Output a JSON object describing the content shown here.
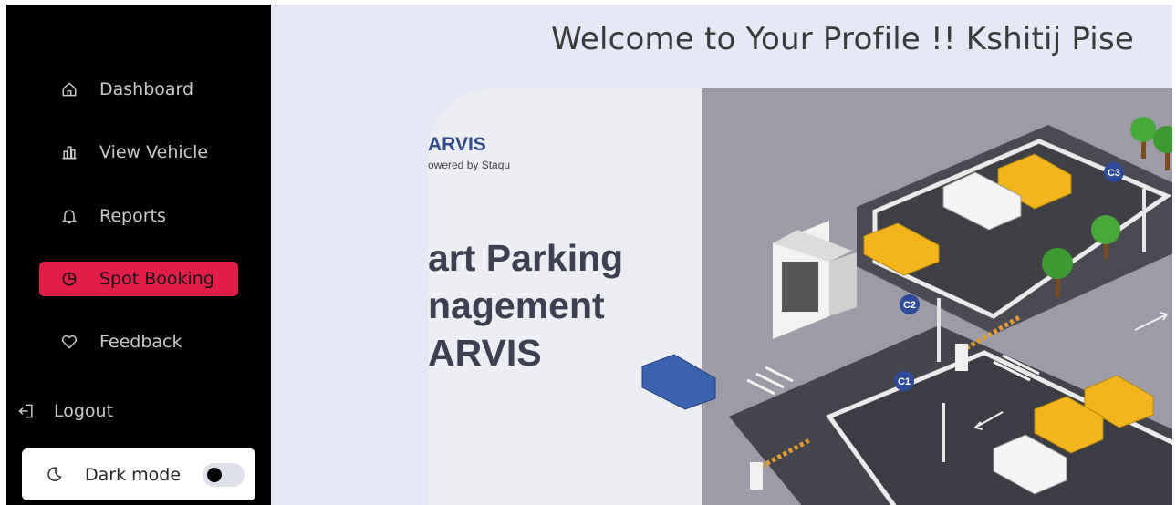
{
  "sidebar": {
    "items": [
      {
        "label": "Dashboard",
        "icon": "home-icon",
        "active": false
      },
      {
        "label": "View Vehicle",
        "icon": "bar-chart-icon",
        "active": false
      },
      {
        "label": "Reports",
        "icon": "bell-icon",
        "active": false
      },
      {
        "label": "Spot Booking",
        "icon": "pie-chart-icon",
        "active": true
      },
      {
        "label": "Feedback",
        "icon": "heart-icon",
        "active": false
      }
    ],
    "logout_label": "Logout",
    "dark_mode_label": "Dark mode",
    "dark_mode_on": false
  },
  "header": {
    "welcome_text": "Welcome to Your Profile !! Kshitij Pise"
  },
  "banner": {
    "brand_name": "ARVIS",
    "brand_sub": "owered by Staqu",
    "headline_lines": [
      "art Parking",
      "nagement",
      "ARVIS"
    ],
    "zone_labels": [
      "C3",
      "C2",
      "C1"
    ]
  },
  "colors": {
    "sidebar_bg": "#000000",
    "active_item": "#e11d48",
    "page_bg": "#e4e9f5"
  }
}
